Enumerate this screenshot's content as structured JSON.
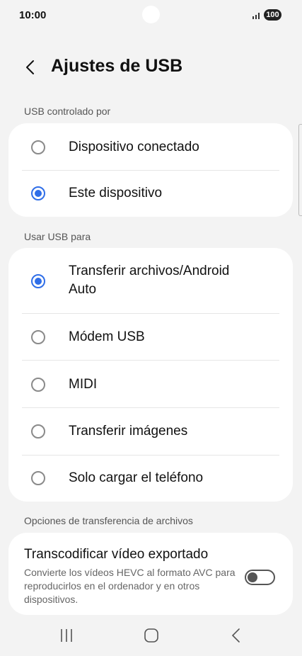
{
  "status_bar": {
    "time": "10:00",
    "signal_icon": "signal-icon",
    "battery": "100"
  },
  "header": {
    "back_icon": "chevron-left-icon",
    "title": "Ajustes de USB"
  },
  "section_controlled": {
    "label": "USB controlado por",
    "options": [
      {
        "label": "Dispositivo conectado",
        "selected": false
      },
      {
        "label": "Este dispositivo",
        "selected": true
      }
    ]
  },
  "section_use": {
    "label": "Usar USB para",
    "options": [
      {
        "label": "Transferir archivos/Android Auto",
        "selected": true
      },
      {
        "label": "Módem USB",
        "selected": false
      },
      {
        "label": "MIDI",
        "selected": false
      },
      {
        "label": "Transferir imágenes",
        "selected": false
      },
      {
        "label": "Solo cargar el teléfono",
        "selected": false
      }
    ]
  },
  "section_transfer": {
    "label": "Opciones de transferencia de archivos",
    "toggle_title": "Transcodificar vídeo exportado",
    "toggle_desc": "Convierte los vídeos HEVC al formato AVC para reproducirlos en el ordenador y en otros dispositivos.",
    "toggle_on": false
  },
  "nav_bar": {
    "icons": [
      "recent-apps-icon",
      "home-icon",
      "back-icon"
    ]
  },
  "colors": {
    "accent": "#2f6ee8",
    "background": "#f3f3f3",
    "card": "#ffffff"
  }
}
